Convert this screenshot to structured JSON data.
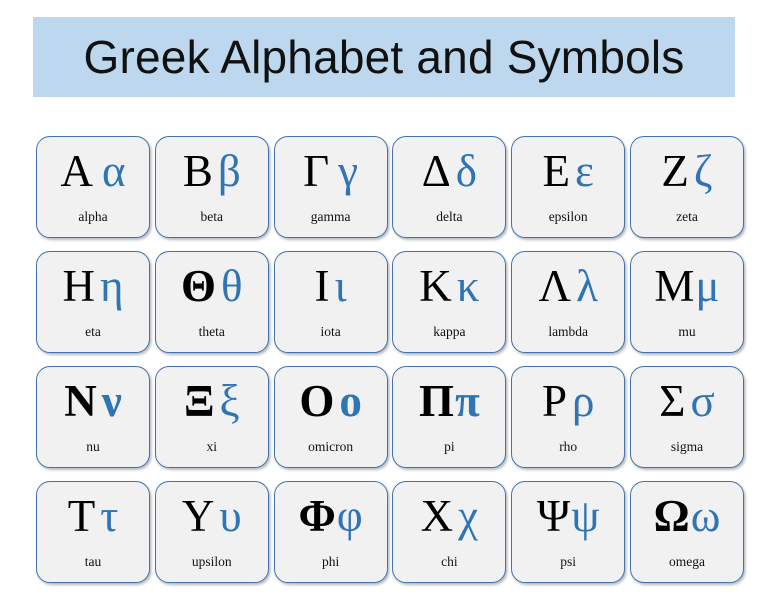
{
  "header": {
    "title": "Greek Alphabet and Symbols",
    "banner_color": "#BDD7EE",
    "title_color": "#111111"
  },
  "style": {
    "card_fill": "#F1F1F1",
    "card_border": "#4472A8",
    "uppercase_color": "#000000",
    "lowercase_color": "#2F74B5",
    "label_color": "#111111"
  },
  "grid": {
    "columns": 6,
    "rows": 4,
    "letters": [
      {
        "upper": "Α",
        "lower": "α",
        "name": "alpha",
        "spacing": "wide",
        "upper_bold": false,
        "lower_bold": false
      },
      {
        "upper": "Β",
        "lower": "β",
        "name": "beta",
        "spacing": "mid",
        "upper_bold": false,
        "lower_bold": false
      },
      {
        "upper": "Γ",
        "lower": "γ",
        "name": "gamma",
        "spacing": "wide",
        "upper_bold": false,
        "lower_bold": false
      },
      {
        "upper": "Δ",
        "lower": "δ",
        "name": "delta",
        "spacing": "mid",
        "upper_bold": false,
        "lower_bold": false
      },
      {
        "upper": "Ε",
        "lower": "ε",
        "name": "epsilon",
        "spacing": "mid",
        "upper_bold": false,
        "lower_bold": false
      },
      {
        "upper": "Ζ",
        "lower": "ζ",
        "name": "zeta",
        "spacing": "mid",
        "upper_bold": false,
        "lower_bold": false
      },
      {
        "upper": "Η",
        "lower": "η",
        "name": "eta",
        "spacing": "mid",
        "upper_bold": false,
        "lower_bold": false
      },
      {
        "upper": "Θ",
        "lower": "θ",
        "name": "theta",
        "spacing": "mid",
        "upper_bold": true,
        "lower_bold": false
      },
      {
        "upper": "Ι",
        "lower": "ι",
        "name": "iota",
        "spacing": "mid",
        "upper_bold": false,
        "lower_bold": false
      },
      {
        "upper": "Κ",
        "lower": "κ",
        "name": "kappa",
        "spacing": "mid",
        "upper_bold": false,
        "lower_bold": false
      },
      {
        "upper": "Λ",
        "lower": "λ",
        "name": "lambda",
        "spacing": "mid",
        "upper_bold": false,
        "lower_bold": false
      },
      {
        "upper": "Μ",
        "lower": "μ",
        "name": "mu",
        "spacing": "tight",
        "upper_bold": false,
        "lower_bold": false
      },
      {
        "upper": "Ν",
        "lower": "ν",
        "name": "nu",
        "spacing": "mid",
        "upper_bold": true,
        "lower_bold": true
      },
      {
        "upper": "Ξ",
        "lower": "ξ",
        "name": "xi",
        "spacing": "mid",
        "upper_bold": true,
        "lower_bold": false
      },
      {
        "upper": "Ο",
        "lower": "ο",
        "name": "omicron",
        "spacing": "mid",
        "upper_bold": true,
        "lower_bold": true
      },
      {
        "upper": "Π",
        "lower": "π",
        "name": "pi",
        "spacing": "tight",
        "upper_bold": true,
        "lower_bold": true
      },
      {
        "upper": "Ρ",
        "lower": "ρ",
        "name": "rho",
        "spacing": "mid",
        "upper_bold": false,
        "lower_bold": false
      },
      {
        "upper": "Σ",
        "lower": "σ",
        "name": "sigma",
        "spacing": "mid",
        "upper_bold": false,
        "lower_bold": false
      },
      {
        "upper": "Τ",
        "lower": "τ",
        "name": "tau",
        "spacing": "mid",
        "upper_bold": false,
        "lower_bold": false
      },
      {
        "upper": "Υ",
        "lower": "υ",
        "name": "upsilon",
        "spacing": "mid",
        "upper_bold": false,
        "lower_bold": false
      },
      {
        "upper": "Φ",
        "lower": "φ",
        "name": "phi",
        "spacing": "tight",
        "upper_bold": true,
        "lower_bold": false
      },
      {
        "upper": "Χ",
        "lower": "χ",
        "name": "chi",
        "spacing": "mid",
        "upper_bold": false,
        "lower_bold": false
      },
      {
        "upper": "Ψ",
        "lower": "ψ",
        "name": "psi",
        "spacing": "tight",
        "upper_bold": false,
        "lower_bold": false
      },
      {
        "upper": "Ω",
        "lower": "ω",
        "name": "omega",
        "spacing": "tight",
        "upper_bold": true,
        "lower_bold": false
      }
    ]
  }
}
